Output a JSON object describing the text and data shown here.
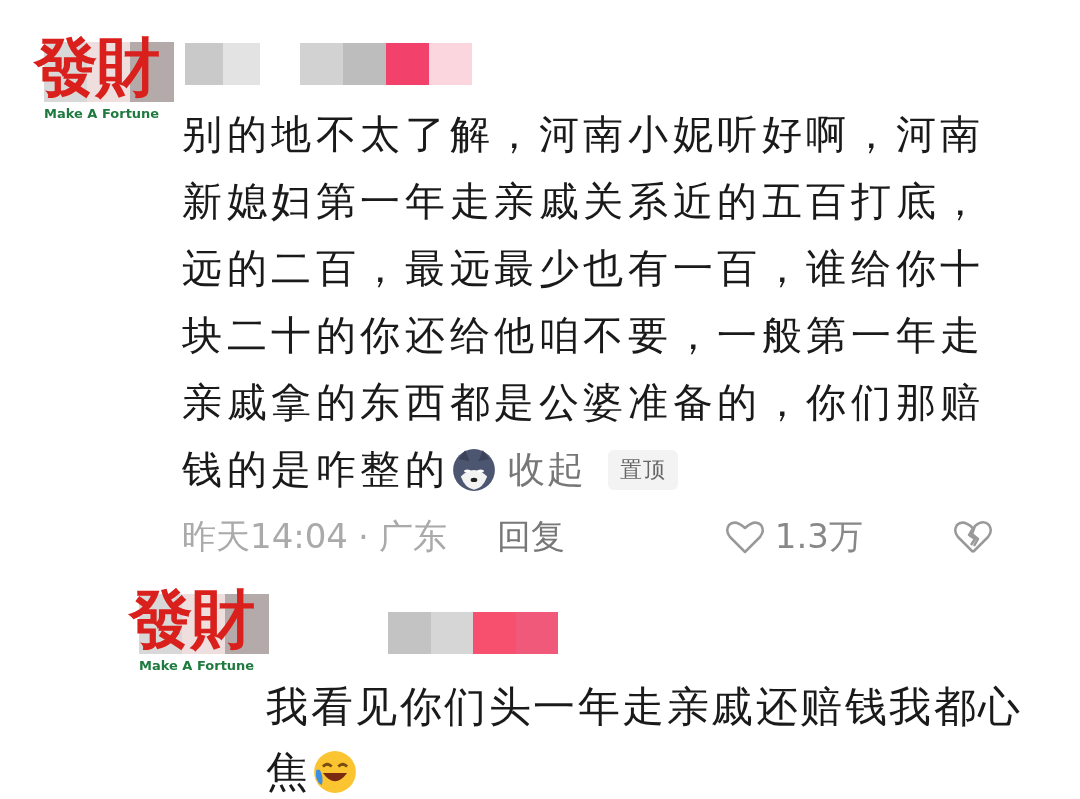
{
  "comments": [
    {
      "avatar": {
        "title": "發財",
        "subtitle": "Make A Fortune"
      },
      "lines": [
        "别的地不太了解，河南小妮听好啊，河南",
        "新媳妇第一年走亲戚关系近的五百打底，",
        "远的二百，最远最少也有一百，谁给你十",
        "块二十的你还给他咱不要，一般第一年走",
        "亲戚拿的东西都是公婆准备的，你们那赔",
        "钱的是咋整的"
      ],
      "collapse": "收起",
      "badge": "置顶",
      "time": "昨天14:04",
      "separator": "·",
      "region": "广东",
      "reply": "回复",
      "likes": "1.3万"
    },
    {
      "avatar": {
        "title": "發財",
        "subtitle": "Make A Fortune"
      },
      "lines": [
        "我看见你们头一年走亲戚还赔钱我都心",
        "焦"
      ]
    }
  ]
}
